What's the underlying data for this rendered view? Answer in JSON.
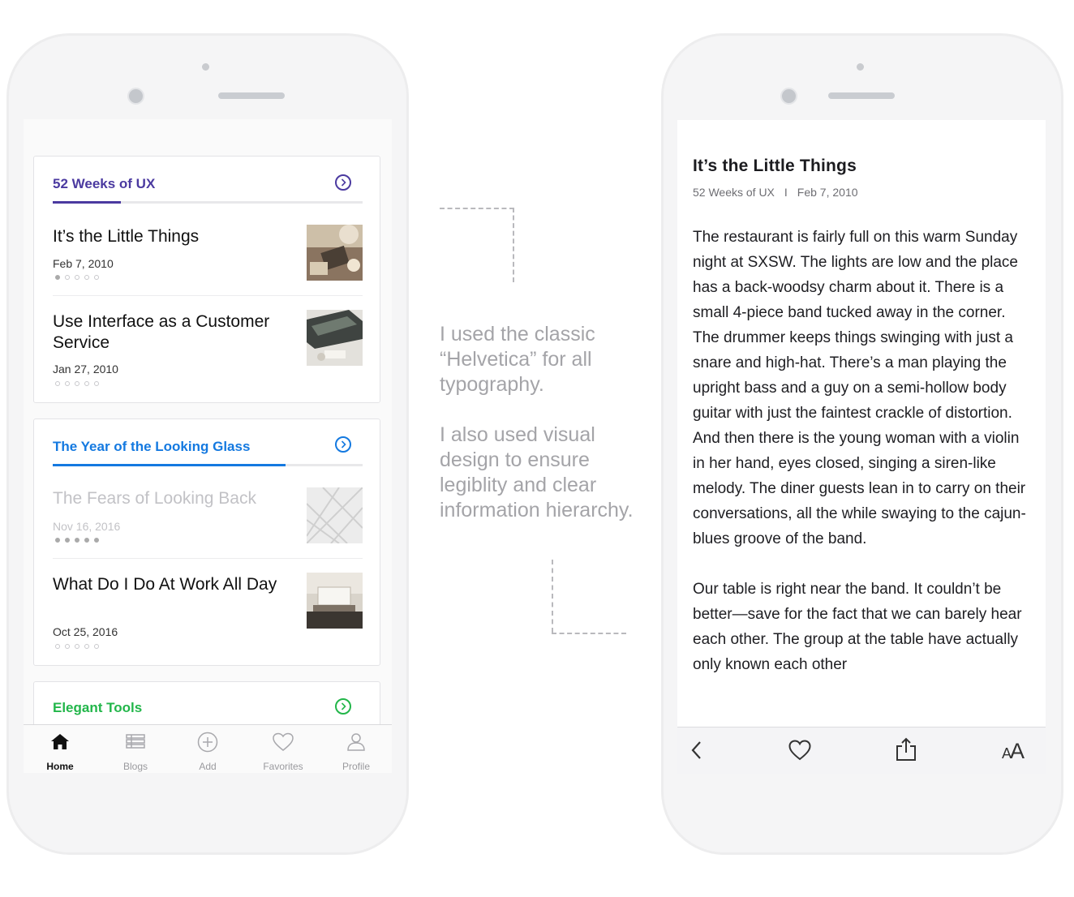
{
  "home": {
    "sections": [
      {
        "title": "52 Weeks of UX",
        "accent": "#4b3aa0",
        "progress": 0.22,
        "items": [
          {
            "title": "It’s the Little Things",
            "date": "Feb 7, 2010",
            "dots_read": 1,
            "dots_total": 5
          },
          {
            "title": "Use Interface as a Customer Service",
            "date": "Jan 27, 2010",
            "dots_read": 0,
            "dots_total": 5
          }
        ]
      },
      {
        "title": "The Year of the Looking Glass",
        "accent": "#1479e0",
        "progress": 0.75,
        "items": [
          {
            "title": "The Fears of Looking Back",
            "date": "Nov 16, 2016",
            "dots_read": 5,
            "dots_total": 5,
            "dimmed": true
          },
          {
            "title": "What Do I Do At Work All Day",
            "date": "Oct 25, 2016",
            "dots_read": 0,
            "dots_total": 5
          }
        ]
      },
      {
        "title": "Elegant Tools",
        "accent": "#22b64a"
      }
    ],
    "tabs": [
      {
        "label": "Home",
        "icon": "home-icon",
        "active": true
      },
      {
        "label": "Blogs",
        "icon": "blogs-icon"
      },
      {
        "label": "Add",
        "icon": "add-icon"
      },
      {
        "label": "Favorites",
        "icon": "heart-icon"
      },
      {
        "label": "Profile",
        "icon": "profile-icon"
      }
    ]
  },
  "annotation": {
    "paragraph1": "I used the classic “Helvetica” for all typography.",
    "paragraph2": "I also used visual design to ensure legiblity and clear information hierarchy."
  },
  "article": {
    "title": "It’s the Little Things",
    "series": "52 Weeks of UX",
    "separator": "I",
    "date": "Feb 7, 2010",
    "body1": "The restaurant is fairly full on this warm Sunday night at SXSW. The lights are low and the place has a back-woodsy charm about it. There is a small 4-piece band tucked away in the corner. The drummer keeps things swinging with just a snare and high-hat. There’s a man playing the upright bass and a guy on a semi-hollow body guitar with just the faintest crackle of distortion. And then there is the young woman with a violin in her hand, eyes closed, singing a siren-like melody. The diner guests lean in to carry on their conversations, all the while swaying to the cajun-blues groove of the band.",
    "body2": "Our table is right near the band. It couldn’t be better—save for the fact that we can barely hear each other. The group at the table have actually only known each other",
    "toolbar": {
      "font_size_label": "AA",
      "icons": [
        "back-icon",
        "heart-icon",
        "share-icon",
        "font-size-icon"
      ]
    }
  }
}
